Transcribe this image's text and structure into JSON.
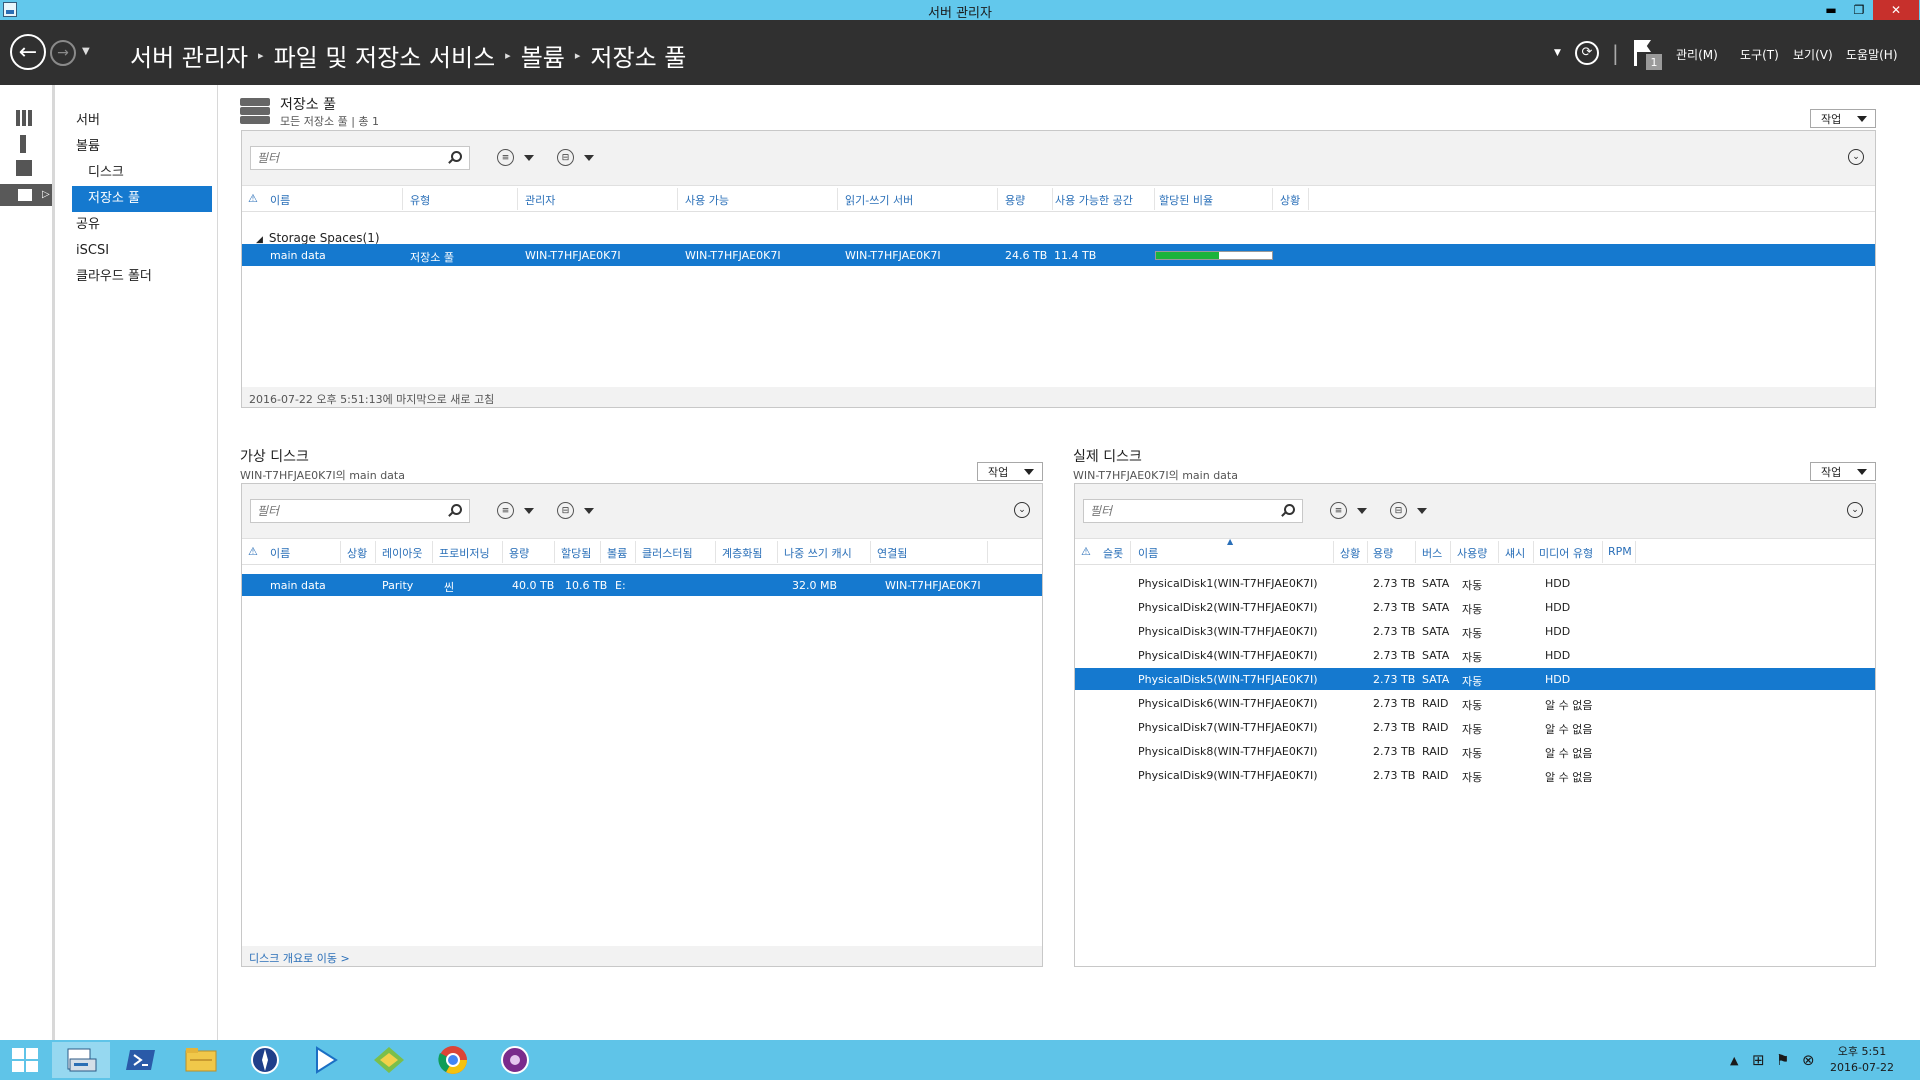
{
  "window": {
    "title": "서버 관리자",
    "minimize_glyph": "▬",
    "maximize_glyph": "❐",
    "close_glyph": "✕"
  },
  "nav": {
    "back_glyph": "←",
    "forward_glyph": "→",
    "dropdown_glyph": "▼",
    "breadcrumb": [
      "서버 관리자",
      "파일 및 저장소 서비스",
      "볼륨",
      "저장소 풀"
    ],
    "breadcrumb_sep": "▸",
    "refresh_dropdown_glyph": "▼",
    "refresh_glyph": "⟳",
    "divider": "|",
    "notification_count": "1",
    "menus": [
      "관리(M)",
      "도구(T)",
      "보기(V)",
      "도움말(H)"
    ]
  },
  "rail": {
    "icons": [
      "dashboard-icon",
      "local-server-icon",
      "all-servers-icon",
      "file-storage-icon"
    ],
    "arrow_glyph": "▷"
  },
  "sidebar": {
    "items": [
      "서버",
      "볼륨",
      "디스크",
      "저장소 풀",
      "공유",
      "iSCSI",
      "클라우드 폴더"
    ],
    "selected_index": 3
  },
  "pool_section": {
    "title": "저장소 풀",
    "subtitle": "모든 저장소 풀 | 총 1",
    "task_label": "작업",
    "filter_placeholder": "필터",
    "list_glyph": "≡",
    "save_glyph": "⊟",
    "expand_glyph": "⌄",
    "sort_glyph": "⚠",
    "columns": [
      "이름",
      "유형",
      "관리자",
      "사용 가능",
      "읽기-쓰기 서버",
      "용량",
      "사용 가능한 공간",
      "할당된 비율",
      "상황"
    ],
    "group_label": "Storage Spaces(1)",
    "group_glyph": "◢",
    "rows": [
      {
        "name": "main data",
        "type": "저장소 풀",
        "manager": "WIN-T7HFJAE0K7I",
        "available": "WIN-T7HFJAE0K7I",
        "rw_server": "WIN-T7HFJAE0K7I",
        "capacity": "24.6 TB",
        "free": "11.4 TB",
        "allocated_fraction": 0.54
      }
    ],
    "footer": "2016-07-22 오후 5:51:13에 마지막으로 새로 고침"
  },
  "vdisk_section": {
    "title": "가상 디스크",
    "subtitle": "WIN-T7HFJAE0K7I의 main data",
    "task_label": "작업",
    "filter_placeholder": "필터",
    "columns": [
      "이름",
      "상황",
      "레이아웃",
      "프로비저닝",
      "용량",
      "할당됨",
      "볼륨",
      "클러스터됨",
      "계층화됨",
      "나중 쓰기 캐시",
      "연결됨"
    ],
    "rows": [
      {
        "name": "main data",
        "layout": "Parity",
        "provisioning": "씬",
        "capacity": "40.0 TB",
        "allocated": "10.6 TB",
        "volume": "E:",
        "cache": "32.0 MB",
        "attached": "WIN-T7HFJAE0K7I"
      }
    ],
    "footer": "디스크 개요로 이동 >"
  },
  "pdisk_section": {
    "title": "실제 디스크",
    "subtitle": "WIN-T7HFJAE0K7I의 main data",
    "task_label": "작업",
    "filter_placeholder": "필터",
    "sort_indicator": "▲",
    "columns": [
      "슬롯",
      "이름",
      "상황",
      "용량",
      "버스",
      "사용량",
      "섀시",
      "미디어 유형",
      "RPM"
    ],
    "rows": [
      {
        "name": "PhysicalDisk1(WIN-T7HFJAE0K7I)",
        "capacity": "2.73 TB",
        "bus": "SATA",
        "usage": "자동",
        "media": "HDD"
      },
      {
        "name": "PhysicalDisk2(WIN-T7HFJAE0K7I)",
        "capacity": "2.73 TB",
        "bus": "SATA",
        "usage": "자동",
        "media": "HDD"
      },
      {
        "name": "PhysicalDisk3(WIN-T7HFJAE0K7I)",
        "capacity": "2.73 TB",
        "bus": "SATA",
        "usage": "자동",
        "media": "HDD"
      },
      {
        "name": "PhysicalDisk4(WIN-T7HFJAE0K7I)",
        "capacity": "2.73 TB",
        "bus": "SATA",
        "usage": "자동",
        "media": "HDD"
      },
      {
        "name": "PhysicalDisk5(WIN-T7HFJAE0K7I)",
        "capacity": "2.73 TB",
        "bus": "SATA",
        "usage": "자동",
        "media": "HDD"
      },
      {
        "name": "PhysicalDisk6(WIN-T7HFJAE0K7I)",
        "capacity": "2.73 TB",
        "bus": "RAID",
        "usage": "자동",
        "media": "알 수 없음"
      },
      {
        "name": "PhysicalDisk7(WIN-T7HFJAE0K7I)",
        "capacity": "2.73 TB",
        "bus": "RAID",
        "usage": "자동",
        "media": "알 수 없음"
      },
      {
        "name": "PhysicalDisk8(WIN-T7HFJAE0K7I)",
        "capacity": "2.73 TB",
        "bus": "RAID",
        "usage": "자동",
        "media": "알 수 없음"
      },
      {
        "name": "PhysicalDisk9(WIN-T7HFJAE0K7I)",
        "capacity": "2.73 TB",
        "bus": "RAID",
        "usage": "자동",
        "media": "알 수 없음"
      }
    ],
    "selected_index": 4
  },
  "taskbar": {
    "apps": [
      "start-icon",
      "server-manager-icon",
      "powershell-icon",
      "file-explorer-icon",
      "app-compass-icon",
      "media-play-icon",
      "app-diamond-icon",
      "chrome-icon",
      "app-purple-icon"
    ],
    "tray_up_glyph": "▲",
    "tray_network_glyph": "⊞",
    "tray_people_glyph": "⚑",
    "tray_close_glyph": "⊗",
    "time": "오후 5:51",
    "date": "2016-07-22"
  },
  "colors": {
    "accent": "#1579cf",
    "titlebar": "#62c8ec",
    "navbar": "#303030",
    "taskbar": "#5fc4e8",
    "progress": "#1bb33b"
  }
}
